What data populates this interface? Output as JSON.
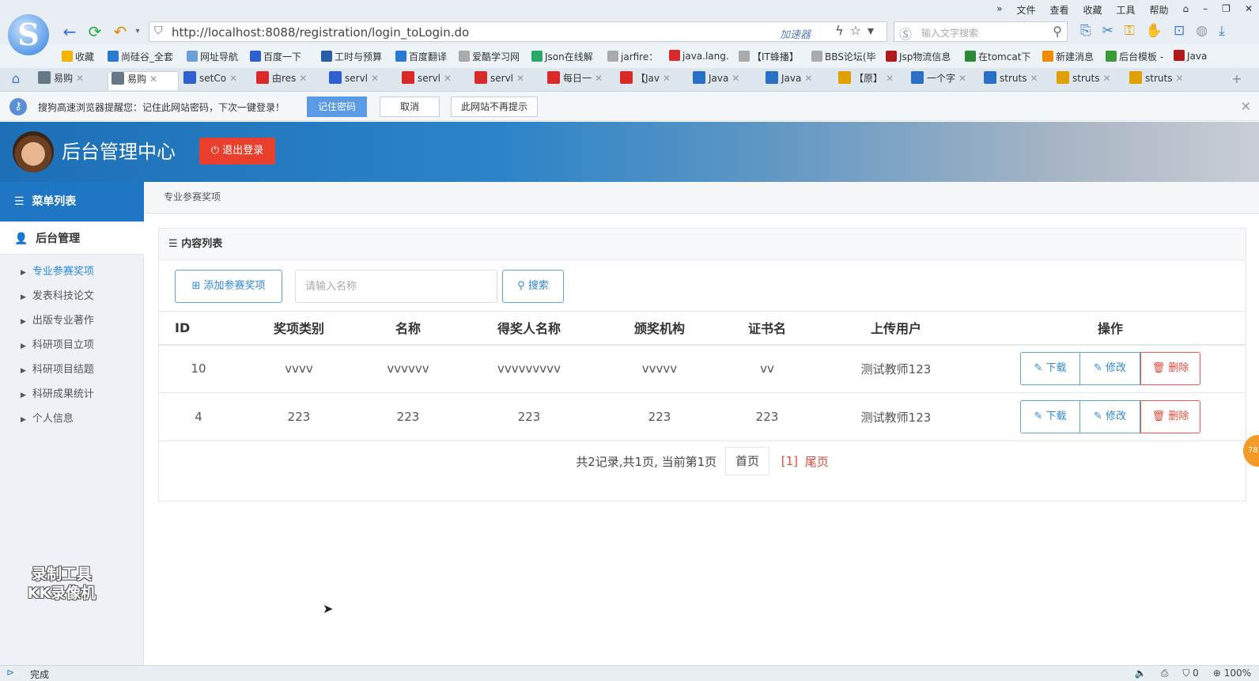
{
  "browser": {
    "sys_menu": [
      "»",
      "文件",
      "查看",
      "收藏",
      "工具",
      "帮助"
    ],
    "url": "http://localhost:8088/registration/login_toLogin.do",
    "accelerator_label": "加速器",
    "search_placeholder": "输入文字搜索",
    "bookmarks": [
      {
        "label": "收藏",
        "color": "#f0b400"
      },
      {
        "label": "尚硅谷_全套",
        "color": "#2a7ad2"
      },
      {
        "label": "网址导航",
        "color": "#6aa0d8"
      },
      {
        "label": "百度一下",
        "color": "#3060d0"
      },
      {
        "label": "工时与预算",
        "color": "#2a5da8"
      },
      {
        "label": "百度翻译",
        "color": "#2a7ad2"
      },
      {
        "label": "爱酷学习网",
        "color": "#aaaaaa"
      },
      {
        "label": "Json在线解",
        "color": "#2aa86a"
      },
      {
        "label": "jarfire：",
        "color": "#aaaaaa"
      },
      {
        "label": "java.lang.",
        "color": "#d82a2a"
      },
      {
        "label": "【IT蜂播】",
        "color": "#aaaaaa"
      },
      {
        "label": "BBS论坛(毕",
        "color": "#aaaaaa"
      },
      {
        "label": "Jsp物流信息",
        "color": "#b01a1a"
      },
      {
        "label": "在tomcat下",
        "color": "#2a8a3a"
      },
      {
        "label": "新建消息",
        "color": "#f08a00"
      },
      {
        "label": "后台模板 -",
        "color": "#3a9a3a"
      },
      {
        "label": "Java",
        "color": "#b01a1a"
      }
    ],
    "tabs": [
      {
        "label": "易购",
        "color": "#667788"
      },
      {
        "label": "易购",
        "color": "#667788",
        "active": true
      },
      {
        "label": "setCo",
        "color": "#3060d0"
      },
      {
        "label": "由res",
        "color": "#d82a2a"
      },
      {
        "label": "servl",
        "color": "#3060d0"
      },
      {
        "label": "servl",
        "color": "#d82a2a"
      },
      {
        "label": "servl",
        "color": "#d82a2a"
      },
      {
        "label": "每日一",
        "color": "#d82a2a"
      },
      {
        "label": "【Jav",
        "color": "#d82a2a"
      },
      {
        "label": "Java",
        "color": "#2a6fc4"
      },
      {
        "label": "Java",
        "color": "#2a6fc4"
      },
      {
        "label": "【原】",
        "color": "#e0a000"
      },
      {
        "label": "一个字",
        "color": "#2a6fc4"
      },
      {
        "label": "struts",
        "color": "#2a6fc4"
      },
      {
        "label": "struts",
        "color": "#e0a000"
      },
      {
        "label": "struts",
        "color": "#e0a000"
      }
    ],
    "notify": {
      "text": "搜狗高速浏览器提醒您：记住此网站密码，下次一键登录！",
      "remember": "记住密码",
      "cancel": "取消",
      "never": "此网站不再提示"
    },
    "status": {
      "text": "完成",
      "zoom": "100%",
      "count": "0"
    }
  },
  "app": {
    "title": "后台管理中心",
    "logout": "退出登录",
    "sidebar": {
      "header": "菜单列表",
      "group": "后台管理",
      "items": [
        {
          "label": "专业参赛奖项",
          "active": true
        },
        {
          "label": "发表科技论文"
        },
        {
          "label": "出版专业著作"
        },
        {
          "label": "科研项目立项"
        },
        {
          "label": "科研项目结题"
        },
        {
          "label": "科研成果统计"
        },
        {
          "label": "个人信息"
        }
      ]
    },
    "breadcrumb": "专业参赛奖项",
    "panel_title": "内容列表",
    "add_button": "添加参赛奖项",
    "search": {
      "placeholder": "请输入名称",
      "value": "",
      "button": "搜索"
    },
    "table": {
      "headers": [
        "ID",
        "奖项类别",
        "名称",
        "得奖人名称",
        "颁奖机构",
        "证书名",
        "上传用户",
        "操作"
      ],
      "rows": [
        [
          "10",
          "vvvv",
          "vvvvvv",
          "vvvvvvvvv",
          "vvvvv",
          "vv",
          "测试教师123"
        ],
        [
          "4",
          "223",
          "223",
          "223",
          "223",
          "223",
          "测试教师123"
        ]
      ],
      "actions": {
        "download": "下载",
        "edit": "修改",
        "delete": "删除"
      }
    },
    "pagination": {
      "info": "共2记录,共1页, 当前第1页",
      "first": "首页",
      "current": "[1]",
      "last": "尾页"
    },
    "watermark": [
      "录制工具",
      "KK录像机"
    ],
    "float_badge": "78"
  }
}
